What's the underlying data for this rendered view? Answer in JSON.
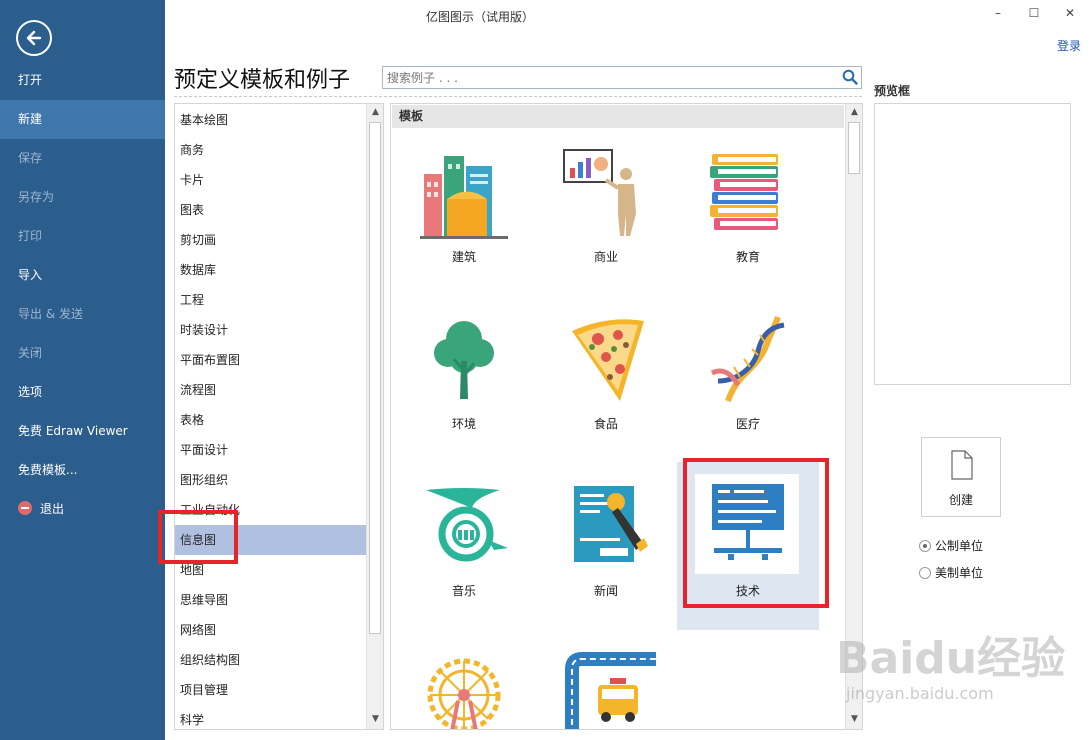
{
  "app_title": "亿图图示（试用版）",
  "window_controls": {
    "minimize": "–",
    "maximize": "☐",
    "close": "✕"
  },
  "login": "登录",
  "sidebar": {
    "items": [
      {
        "label": "打开",
        "state": "normal"
      },
      {
        "label": "新建",
        "state": "active"
      },
      {
        "label": "保存",
        "state": "disabled"
      },
      {
        "label": "另存为",
        "state": "disabled"
      },
      {
        "label": "打印",
        "state": "disabled"
      },
      {
        "label": "导入",
        "state": "normal"
      },
      {
        "label": "导出 & 发送",
        "state": "disabled"
      },
      {
        "label": "关闭",
        "state": "disabled"
      },
      {
        "label": "选项",
        "state": "normal"
      },
      {
        "label": "免费 Edraw Viewer",
        "state": "normal"
      },
      {
        "label": "免费模板...",
        "state": "normal"
      },
      {
        "label": "退出",
        "state": "normal"
      }
    ]
  },
  "page_title": "预定义模板和例子",
  "search": {
    "placeholder": "搜索例子 . . .",
    "value": ""
  },
  "categories": [
    "基本绘图",
    "商务",
    "卡片",
    "图表",
    "剪切画",
    "数据库",
    "工程",
    "时装设计",
    "平面布置图",
    "流程图",
    "表格",
    "平面设计",
    "图形组织",
    "工业自动化",
    "信息图",
    "地图",
    "思维导图",
    "网络图",
    "组织结构图",
    "项目管理",
    "科学"
  ],
  "selected_category": "信息图",
  "templates_header": "模板",
  "templates": [
    "建筑",
    "商业",
    "教育",
    "环境",
    "食品",
    "医疗",
    "音乐",
    "新闻",
    "技术",
    "",
    ""
  ],
  "selected_template": "技术",
  "right_pane": {
    "preview_label": "预览框",
    "create_label": "创建",
    "units": [
      {
        "label": "公制单位",
        "selected": true
      },
      {
        "label": "美制单位",
        "selected": false
      }
    ]
  },
  "colors": {
    "sidebar_bg": "#2b5d8d",
    "sidebar_active": "#3f77ac",
    "selected_category_bg": "#b0c0e0",
    "highlight": "#e8242a",
    "link": "#1f57b8"
  },
  "watermark": {
    "logo": "Baidu经验",
    "url": "jingyan.baidu.com"
  }
}
